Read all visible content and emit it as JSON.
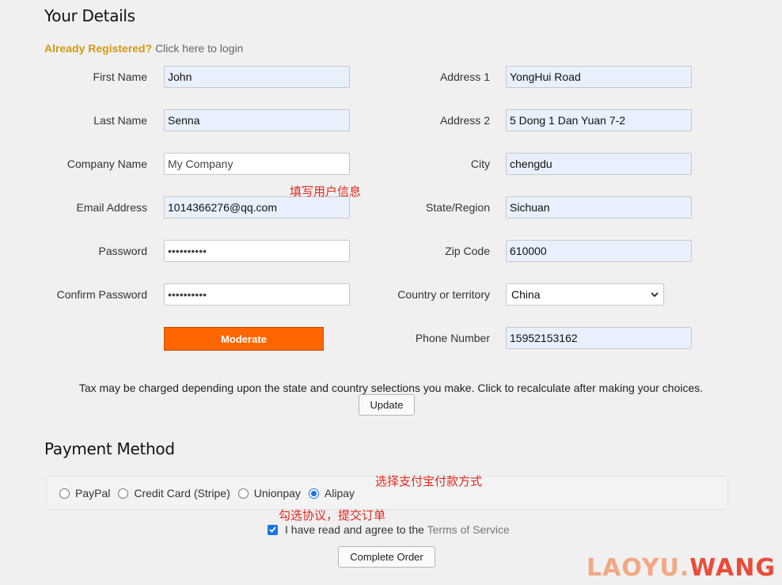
{
  "details": {
    "title": "Your Details",
    "already_registered": "Already Registered?",
    "login_link": "Click here to login",
    "left_fields": [
      {
        "label": "First Name",
        "value": "John"
      },
      {
        "label": "Last Name",
        "value": "Senna"
      },
      {
        "label": "Company Name",
        "value": "My Company"
      },
      {
        "label": "Email Address",
        "value": "1014366276@qq.com"
      },
      {
        "label": "Password",
        "value": "••••••••••"
      },
      {
        "label": "Confirm Password",
        "value": "••••••••••"
      }
    ],
    "right_fields": [
      {
        "label": "Address 1",
        "value": "YongHui Road"
      },
      {
        "label": "Address 2",
        "value": "5 Dong 1 Dan Yuan 7-2"
      },
      {
        "label": "City",
        "value": "chengdu"
      },
      {
        "label": "State/Region",
        "value": "Sichuan"
      },
      {
        "label": "Zip Code",
        "value": "610000"
      },
      {
        "label": "Country or territory",
        "value": "China"
      },
      {
        "label": "Phone Number",
        "value": "15952153162"
      }
    ],
    "strength_button": "Moderate"
  },
  "tax": {
    "notice": "Tax may be charged depending upon the state and country selections you make. Click to recalculate after making your choices.",
    "update_button": "Update"
  },
  "payment": {
    "title": "Payment Method",
    "options": [
      {
        "label": "PayPal",
        "selected": false
      },
      {
        "label": "Credit Card (Stripe)",
        "selected": false
      },
      {
        "label": "Unionpay",
        "selected": false
      },
      {
        "label": "Alipay",
        "selected": true
      }
    ],
    "agree_text": "I have read and agree to the",
    "terms_link": "Terms of Service",
    "agree_checked": true,
    "complete_button": "Complete Order"
  },
  "annotations": {
    "fill_info": "填写用户信息",
    "choose_alipay": "选择支付宝付款方式",
    "agree_submit": "勾选协议，提交订单"
  },
  "watermark": {
    "part1": "LAOYU.",
    "part2": "WANG"
  },
  "colors": {
    "accent_orange": "#ff6600",
    "login_orange": "#d49a12",
    "annotation_red": "#e0281e",
    "input_autofill": "#e8f0fe"
  }
}
